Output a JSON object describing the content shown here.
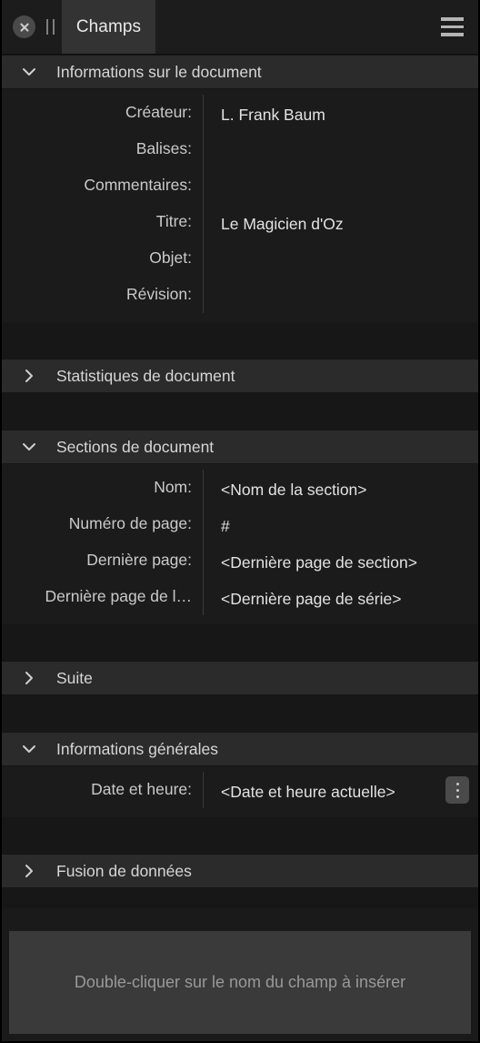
{
  "titlebar": {
    "close_icon": "close-circle-icon",
    "drag_handle_icon": "drag-handle-icon",
    "tab_label": "Champs",
    "menu_icon": "hamburger-menu-icon"
  },
  "sections": [
    {
      "id": "document-information",
      "title": "Informations sur le document",
      "expanded": true,
      "chevron": "chevron-down-icon",
      "rows": [
        {
          "label": "Créateur:",
          "value": "L. Frank Baum"
        },
        {
          "label": "Balises:",
          "value": ""
        },
        {
          "label": "Commentaires:",
          "value": ""
        },
        {
          "label": "Titre:",
          "value": "Le Magicien d'Oz"
        },
        {
          "label": "Objet:",
          "value": ""
        },
        {
          "label": "Révision:",
          "value": ""
        }
      ]
    },
    {
      "id": "document-statistics",
      "title": "Statistiques de document",
      "expanded": false,
      "chevron": "chevron-right-icon",
      "rows": []
    },
    {
      "id": "document-sections",
      "title": "Sections de document",
      "expanded": true,
      "chevron": "chevron-down-icon",
      "rows": [
        {
          "label": "Nom:",
          "value": "<Nom de la section>"
        },
        {
          "label": "Numéro de page:",
          "value": "#"
        },
        {
          "label": "Dernière page:",
          "value": "<Dernière page de section>"
        },
        {
          "label": "Dernière page de l…",
          "value": "<Dernière page de série>"
        }
      ]
    },
    {
      "id": "continuation",
      "title": "Suite",
      "expanded": false,
      "chevron": "chevron-right-icon",
      "rows": []
    },
    {
      "id": "general-information",
      "title": "Informations générales",
      "expanded": true,
      "chevron": "chevron-down-icon",
      "rows": [
        {
          "label": "Date et heure:",
          "value": "<Date et heure actuelle>",
          "menu": true
        }
      ]
    },
    {
      "id": "data-merge",
      "title": "Fusion de données",
      "expanded": false,
      "chevron": "chevron-right-icon",
      "rows": []
    }
  ],
  "footer": {
    "hint": "Double-cliquer sur le nom du champ à insérer"
  },
  "colors": {
    "panel_bg": "#1a1a1a",
    "section_header_bg": "#2b2b2b",
    "section_body_bg": "#1b1b1b",
    "gap_bg": "#171717",
    "tab_bg": "#333333",
    "hint_bg": "#3a3a3a",
    "label_text": "#cacaca",
    "value_text": "#e3e3e3",
    "hint_text": "#999999"
  }
}
